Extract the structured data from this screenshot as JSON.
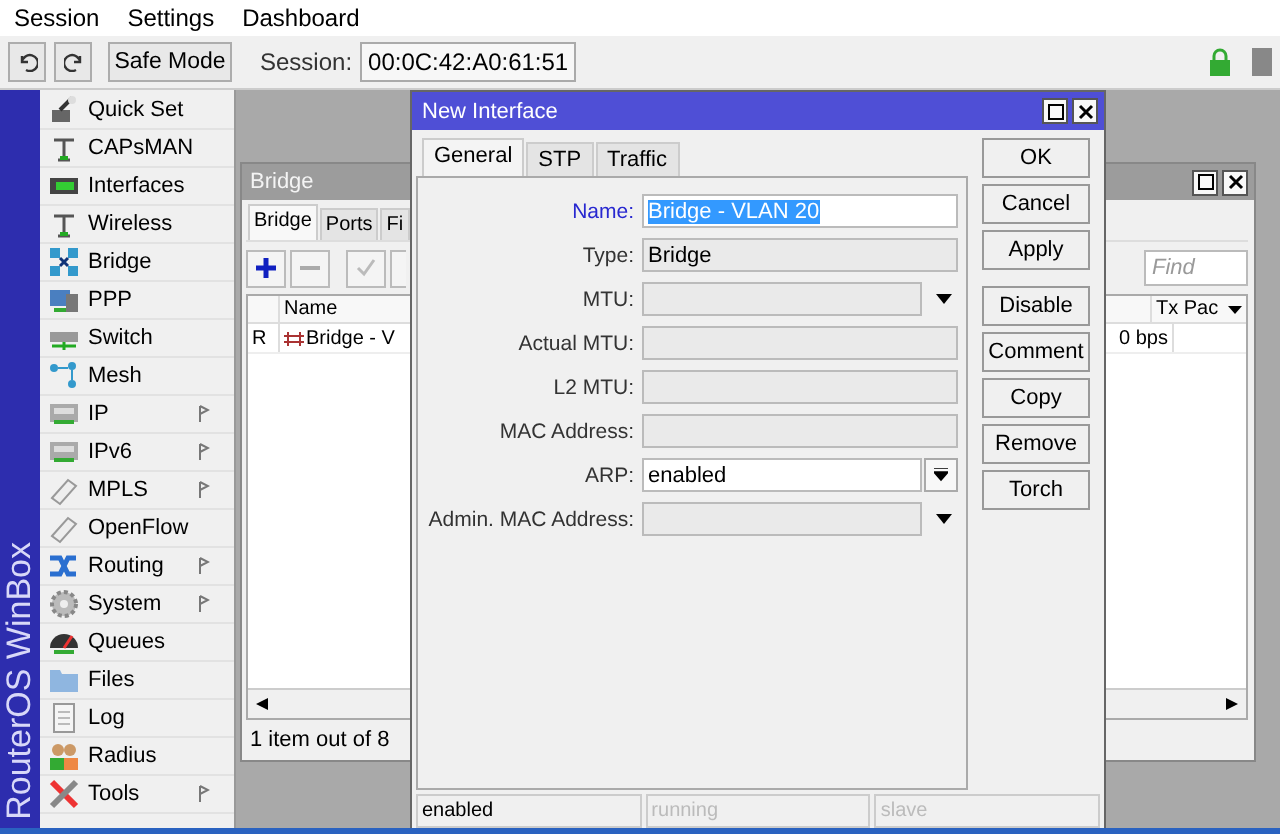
{
  "menu": [
    "Session",
    "Settings",
    "Dashboard"
  ],
  "toolbar": {
    "safe_mode": "Safe Mode",
    "session_label": "Session:",
    "session_value": "00:0C:42:A0:61:51"
  },
  "brand": "RouterOS WinBox",
  "sidebar": [
    {
      "label": "Quick Set",
      "has_submenu": false
    },
    {
      "label": "CAPsMAN",
      "has_submenu": false
    },
    {
      "label": "Interfaces",
      "has_submenu": false
    },
    {
      "label": "Wireless",
      "has_submenu": false
    },
    {
      "label": "Bridge",
      "has_submenu": false
    },
    {
      "label": "PPP",
      "has_submenu": false
    },
    {
      "label": "Switch",
      "has_submenu": false
    },
    {
      "label": "Mesh",
      "has_submenu": false
    },
    {
      "label": "IP",
      "has_submenu": true
    },
    {
      "label": "IPv6",
      "has_submenu": true
    },
    {
      "label": "MPLS",
      "has_submenu": true
    },
    {
      "label": "OpenFlow",
      "has_submenu": false
    },
    {
      "label": "Routing",
      "has_submenu": true
    },
    {
      "label": "System",
      "has_submenu": true
    },
    {
      "label": "Queues",
      "has_submenu": false
    },
    {
      "label": "Files",
      "has_submenu": false
    },
    {
      "label": "Log",
      "has_submenu": false
    },
    {
      "label": "Radius",
      "has_submenu": false
    },
    {
      "label": "Tools",
      "has_submenu": true
    }
  ],
  "bridge_window": {
    "title": "Bridge",
    "tabs": [
      {
        "label": "Bridge",
        "selected": true
      },
      {
        "label": "Ports",
        "selected": false
      },
      {
        "label": "Fi",
        "selected": false
      }
    ],
    "find": {
      "placeholder": "Find"
    },
    "columns": [
      "Name",
      "Tx Pac"
    ],
    "rows": [
      {
        "flag": "R",
        "name": "Bridge - V",
        "rate": "0 bps"
      }
    ],
    "status": "1 item out of 8"
  },
  "dialog": {
    "title": "New Interface",
    "tabs": [
      {
        "label": "General",
        "selected": true
      },
      {
        "label": "STP",
        "selected": false
      },
      {
        "label": "Traffic",
        "selected": false
      }
    ],
    "fields": [
      {
        "label": "Name:",
        "value": "Bridge - VLAN 20",
        "kind": "text",
        "enabled": true,
        "focused": true
      },
      {
        "label": "Type:",
        "value": "Bridge",
        "kind": "text",
        "enabled": false,
        "focused": false
      },
      {
        "label": "MTU:",
        "kind": "combo",
        "enabled": false,
        "focused": false
      },
      {
        "label": "Actual MTU:",
        "kind": "text",
        "enabled": false,
        "focused": false
      },
      {
        "label": "L2 MTU:",
        "kind": "text",
        "enabled": false,
        "focused": false
      },
      {
        "label": "MAC Address:",
        "kind": "text",
        "enabled": false,
        "focused": false
      },
      {
        "label": "ARP:",
        "value": "enabled",
        "kind": "select",
        "enabled": true,
        "focused": false
      },
      {
        "label": "Admin. MAC Address:",
        "kind": "combo",
        "enabled": false,
        "focused": false
      }
    ],
    "buttons": [
      "OK",
      "Cancel",
      "Apply"
    ],
    "actions": [
      "Disable",
      "Comment",
      "Copy",
      "Remove",
      "Torch"
    ],
    "status": [
      {
        "label": "enabled",
        "active": true
      },
      {
        "label": "running",
        "active": false
      },
      {
        "label": "slave",
        "active": false
      }
    ]
  }
}
